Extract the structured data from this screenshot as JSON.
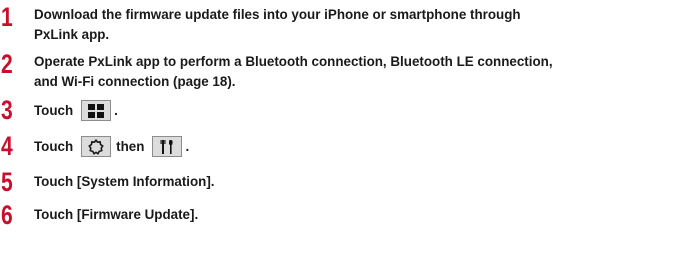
{
  "steps": [
    {
      "number": "1",
      "lines": [
        "Download the firmware update files into your iPhone or smartphone through",
        "PxLink app."
      ]
    },
    {
      "number": "2",
      "lines": [
        "Operate PxLink app to perform a Bluetooth connection, Bluetooth LE connection,",
        "and Wi-Fi connection (page 18)."
      ]
    },
    {
      "number": "3",
      "prefix": "Touch",
      "suffix": "."
    },
    {
      "number": "4",
      "prefix": "Touch",
      "middle": "then",
      "suffix": "."
    },
    {
      "number": "5",
      "lines": [
        "Touch [System Information]."
      ]
    },
    {
      "number": "6",
      "lines": [
        "Touch [Firmware Update]."
      ]
    }
  ],
  "icons": {
    "step3": "menu-grid-icon",
    "step4a": "settings-gear-icon",
    "step4b": "tools-icon"
  },
  "colors": {
    "step_number": "#c8102e",
    "icon_button_bg": "#dcdcdc",
    "icon_button_border": "#8c8c8c"
  }
}
